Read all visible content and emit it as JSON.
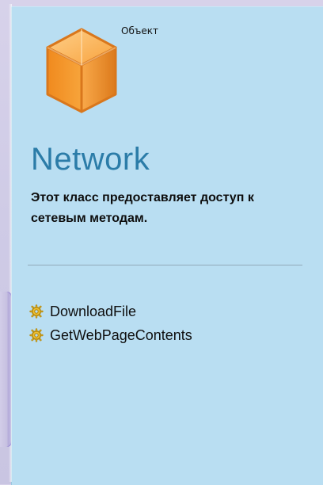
{
  "card": {
    "header": "Объект",
    "title": "Network",
    "description": "Этот класс предоставляет доступ к сетевым методам."
  },
  "methods": [
    "DownloadFile",
    "GetWebPageContents"
  ],
  "icons": {
    "object": "cube-icon",
    "method": "gear-icon"
  },
  "colors": {
    "card_background": "#b9def2",
    "title": "#2b7ca8",
    "cube_primary": "#f79b2e",
    "cube_shadow": "#c96a12",
    "gear": "#f1c232"
  }
}
